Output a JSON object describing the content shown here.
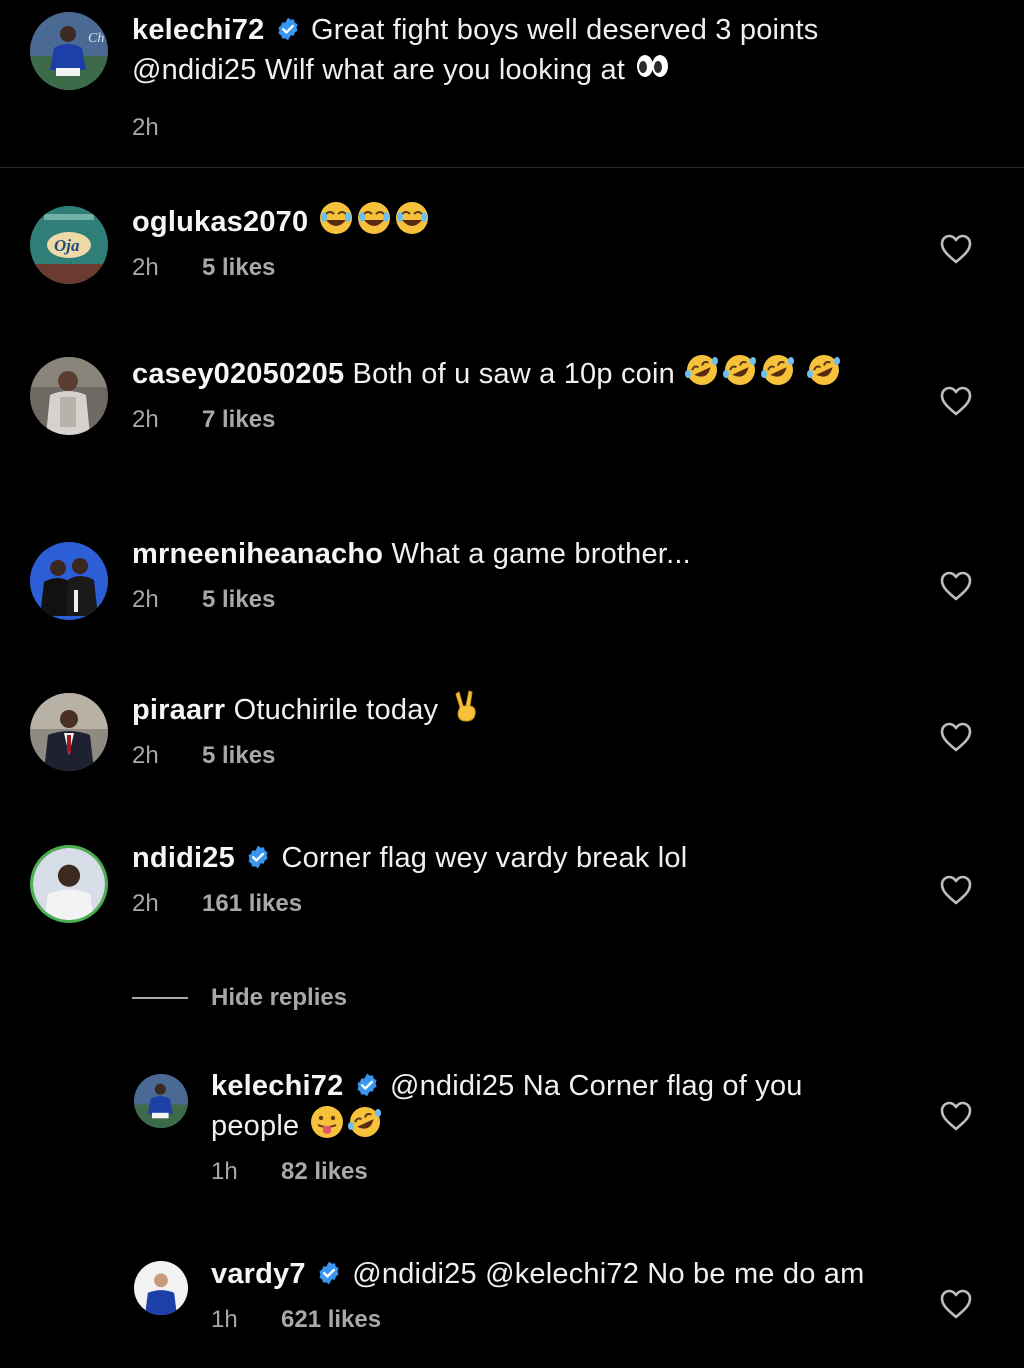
{
  "caption": {
    "username": "kelechi72",
    "verified": true,
    "text": "Great fight boys well deserved 3 points @ndidi25 Wilf what are you looking at",
    "emoji": [
      "eyes"
    ],
    "time": "2h"
  },
  "comments": [
    {
      "username": "oglukas2070",
      "verified": false,
      "text": "",
      "emoji": [
        "joy",
        "joy",
        "joy"
      ],
      "time": "2h",
      "likes": "5 likes"
    },
    {
      "username": "casey02050205",
      "verified": false,
      "text": "Both of u saw a 10p coin",
      "emoji": [
        "rofl",
        "rofl",
        "rofl",
        "rofl"
      ],
      "time": "2h",
      "likes": "7 likes"
    },
    {
      "username": "mrneeniheanacho",
      "verified": false,
      "text": "What a game brother...",
      "emoji": [],
      "time": "2h",
      "likes": "5 likes"
    },
    {
      "username": "piraarr",
      "verified": false,
      "text": "Otuchirile today",
      "emoji": [
        "victory-hand"
      ],
      "time": "2h",
      "likes": "5 likes"
    },
    {
      "username": "ndidi25",
      "verified": true,
      "text": "Corner flag wey vardy break lol",
      "emoji": [],
      "time": "2h",
      "likes": "161 likes"
    }
  ],
  "hide_replies_label": "Hide replies",
  "replies": [
    {
      "username": "kelechi72",
      "verified": true,
      "text": "@ndidi25 Na Corner flag of you people",
      "emoji": [
        "tongue-out",
        "rofl"
      ],
      "time": "1h",
      "likes": "82 likes"
    },
    {
      "username": "vardy7",
      "verified": true,
      "text": "@ndidi25 @kelechi72 No be me do am",
      "emoji": [],
      "time": "1h",
      "likes": "621 likes"
    }
  ],
  "colors": {
    "background": "#000000",
    "text": "#f0f0f0",
    "meta": "#a8a8a8",
    "verified_badge": "#3897f0",
    "divider": "#262626"
  },
  "icons": {
    "like": "heart-outline-icon",
    "verified": "verified-badge-icon"
  }
}
